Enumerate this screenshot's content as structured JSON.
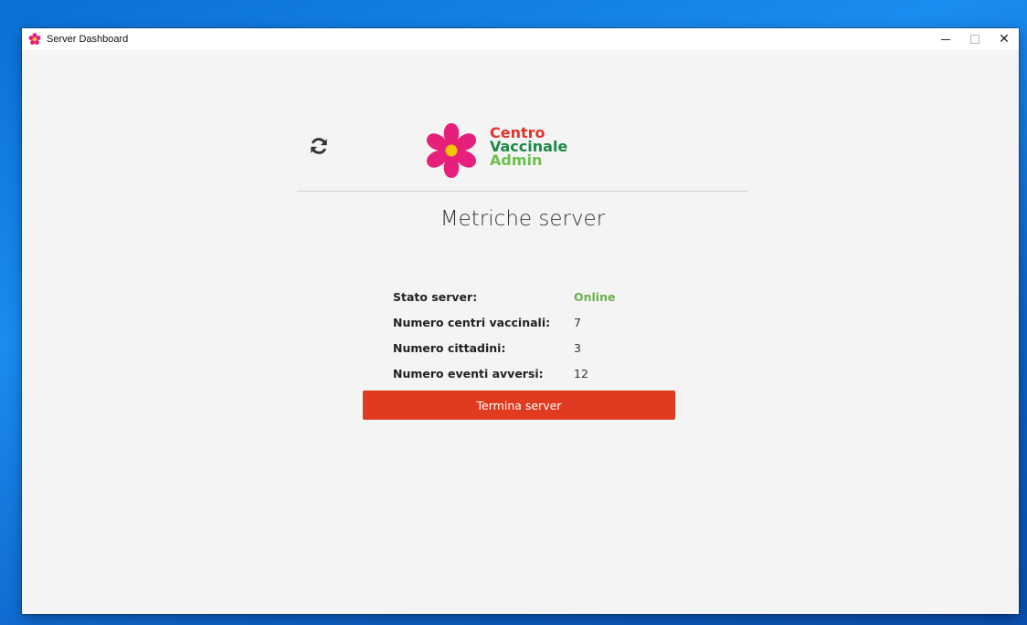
{
  "window": {
    "title": "Server Dashboard",
    "minimize_label": "–",
    "maximize_label": "□",
    "close_label": "✕"
  },
  "brand": {
    "line1": "Centro",
    "line2": "Vaccinale",
    "line3": "Admin",
    "colors": {
      "line1": "#e0342a",
      "line2": "#1c8a45",
      "line3": "#6bbf4e",
      "flower": "#e6207a",
      "center": "#f5c400"
    }
  },
  "icons": {
    "refresh": "refresh-icon",
    "logo": "flower-logo-icon"
  },
  "page": {
    "title": "Metriche server"
  },
  "metrics": [
    {
      "label": "Stato server:",
      "value": "Online"
    },
    {
      "label": "Numero centri vaccinali:",
      "value": "7"
    },
    {
      "label": "Numero cittadini:",
      "value": "3"
    },
    {
      "label": "Numero eventi avversi:",
      "value": "12"
    }
  ],
  "actions": {
    "stop_server_label": "Termina server",
    "stop_color": "#e03a1f"
  }
}
